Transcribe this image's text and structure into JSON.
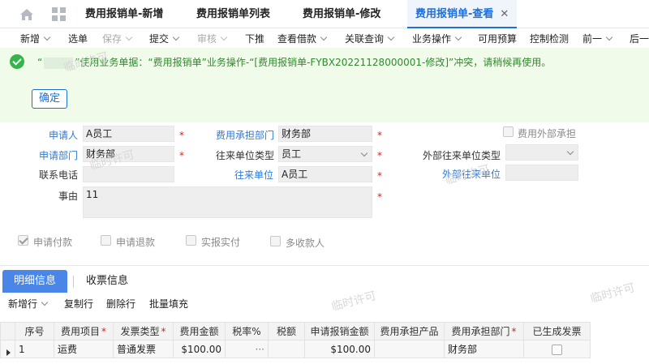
{
  "tabs": [
    "费用报销单-新增",
    "费用报销单列表",
    "费用报销单-修改",
    "费用报销单-查看"
  ],
  "toolbar": {
    "items": [
      "新增",
      "选单",
      "保存",
      "提交",
      "审核",
      "下推",
      "查看借款",
      "关联查询",
      "业务操作",
      "可用预算",
      "控制检测",
      "前一",
      "后一"
    ]
  },
  "alert": {
    "message_prefix": "“",
    "message_body": "”使用业务单据：“费用报销单”业务操作-“[费用报销单-FYBX20221128000001-修改]”冲突，请稍候再使用。",
    "confirm_label": "确定"
  },
  "form": {
    "applicant_label": "申请人",
    "applicant_value": "A员工",
    "cost_dept_label": "费用承担部门",
    "cost_dept_value": "财务部",
    "external_cost_label": "费用外部承担",
    "apply_dept_label": "申请部门",
    "apply_dept_value": "财务部",
    "counterparty_type_label": "往来单位类型",
    "counterparty_type_value": "员工",
    "ext_counterparty_type_label": "外部往来单位类型",
    "phone_label": "联系电话",
    "counterparty_label": "往来单位",
    "counterparty_value": "A员工",
    "ext_counterparty_label": "外部往来单位",
    "reason_label": "事由",
    "reason_value": "11",
    "required_mark": "*"
  },
  "options": {
    "apply_payment": "申请付款",
    "apply_refund": "申请退款",
    "actual_report": "实报实付",
    "multi_payee": "多收款人"
  },
  "watermark": "临时许可",
  "detail_tabs": [
    "明细信息",
    "收票信息"
  ],
  "detail_toolbar": [
    "新增行",
    "复制行",
    "删除行",
    "批量填充"
  ],
  "table": {
    "headers": [
      "序号",
      "费用项目",
      "发票类型",
      "费用金额",
      "税率%",
      "税额",
      "申请报销金额",
      "费用承担产品",
      "费用承担部门",
      "已生成发票"
    ],
    "rows": [
      [
        "1",
        "运费",
        "普通发票",
        "$100.00",
        "···",
        "",
        "$100.00",
        "",
        "财务部",
        ""
      ]
    ]
  }
}
